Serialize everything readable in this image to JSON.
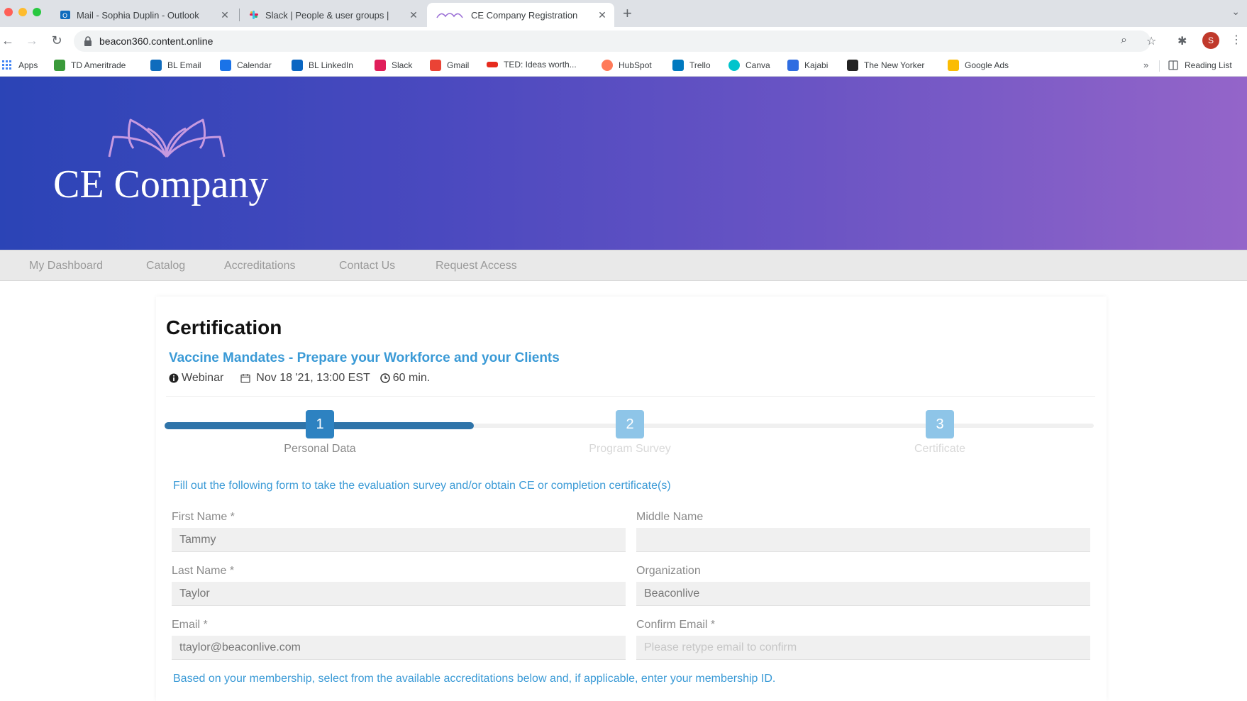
{
  "browser": {
    "tabs": [
      {
        "title": "Mail - Sophia Duplin - Outlook",
        "close": "✕"
      },
      {
        "title": "Slack | People & user groups |",
        "close": "✕"
      },
      {
        "title": "CE Company Registration",
        "close": "✕"
      }
    ],
    "new_tab": "+",
    "address": "beacon360.content.online",
    "bookmarks": [
      {
        "label": "Apps"
      },
      {
        "label": "TD Ameritrade"
      },
      {
        "label": "BL Email"
      },
      {
        "label": "Calendar"
      },
      {
        "label": "BL LinkedIn"
      },
      {
        "label": "Slack"
      },
      {
        "label": "Gmail"
      },
      {
        "label": "TED: Ideas worth..."
      },
      {
        "label": "HubSpot"
      },
      {
        "label": "Trello"
      },
      {
        "label": "Canva"
      },
      {
        "label": "Kajabi"
      },
      {
        "label": "The New Yorker"
      },
      {
        "label": "Google Ads"
      }
    ],
    "bookmarks_more": "»",
    "reading_list": "Reading List",
    "profile_initial": "S"
  },
  "brand": {
    "name": "CE Company",
    "gradient_start": "#2b44b6",
    "gradient_end": "#9465c9"
  },
  "nav": {
    "items": [
      "My Dashboard",
      "Catalog",
      "Accreditations",
      "Contact Us",
      "Request Access"
    ]
  },
  "page": {
    "title": "Certification",
    "course_title": "Vaccine Mandates - Prepare your Workforce and your Clients",
    "meta": {
      "type": "Webinar",
      "date": "Nov 18 '21, 13:00 EST",
      "duration": "60 min."
    },
    "steps": [
      {
        "number": "1",
        "label": "Personal Data",
        "state": "active"
      },
      {
        "number": "2",
        "label": "Program Survey",
        "state": "pending"
      },
      {
        "number": "3",
        "label": "Certificate",
        "state": "pending"
      }
    ],
    "progress_fraction": 0.333,
    "instructions": "Fill out the following form to take the evaluation survey and/or obtain CE or completion certificate(s)",
    "form": {
      "first_name": {
        "label": "First Name *",
        "value": "Tammy"
      },
      "middle_name": {
        "label": "Middle Name",
        "value": ""
      },
      "last_name": {
        "label": "Last Name *",
        "value": "Taylor"
      },
      "organization": {
        "label": "Organization",
        "value": "Beaconlive"
      },
      "email": {
        "label": "Email *",
        "value": "ttaylor@beaconlive.com"
      },
      "confirm_email": {
        "label": "Confirm Email *",
        "value": "",
        "placeholder": "Please retype email to confirm"
      }
    },
    "membership_note": "Based on your membership, select from the available accreditations below and, if applicable, enter your membership ID."
  },
  "colors": {
    "accent_blue": "#3a9ad6",
    "step_active": "#2d82c1",
    "step_pending": "#8ec5e8",
    "progress_fill": "#2f74a9"
  }
}
